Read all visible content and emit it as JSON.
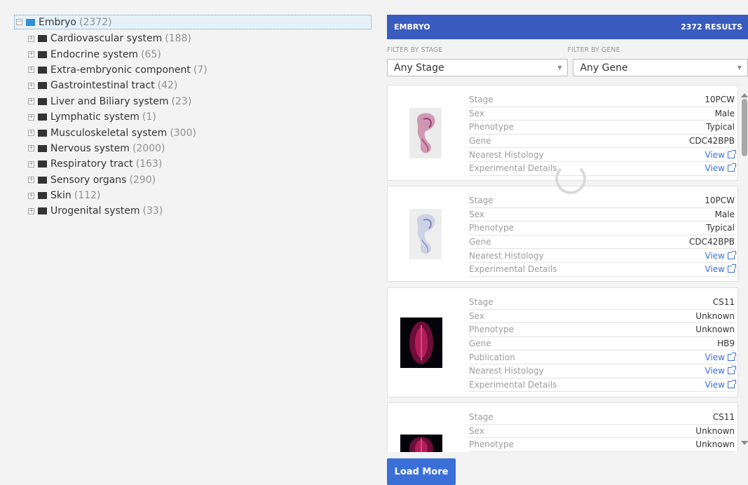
{
  "tree": {
    "root": {
      "label": "Embryo",
      "count": "(2372)"
    },
    "children": [
      {
        "label": "Cardiovascular system",
        "count": "(188)"
      },
      {
        "label": "Endocrine system",
        "count": "(65)"
      },
      {
        "label": "Extra-embryonic component",
        "count": "(7)"
      },
      {
        "label": "Gastrointestinal tract",
        "count": "(42)"
      },
      {
        "label": "Liver and Biliary system",
        "count": "(23)"
      },
      {
        "label": "Lymphatic system",
        "count": "(1)"
      },
      {
        "label": "Musculoskeletal system",
        "count": "(300)"
      },
      {
        "label": "Nervous system",
        "count": "(2000)"
      },
      {
        "label": "Respiratory tract",
        "count": "(163)"
      },
      {
        "label": "Sensory organs",
        "count": "(290)"
      },
      {
        "label": "Skin",
        "count": "(112)"
      },
      {
        "label": "Urogenital system",
        "count": "(33)"
      }
    ]
  },
  "panel": {
    "title": "EMBRYO",
    "results": "2372 RESULTS",
    "filter_stage_label": "FILTER BY STAGE",
    "filter_gene_label": "FILTER BY GENE",
    "stage_value": "Any Stage",
    "gene_value": "Any Gene",
    "load_more": "Load More"
  },
  "cards": [
    {
      "thumb_style": "he-pink",
      "rows": [
        {
          "k": "Stage",
          "v": "10PCW"
        },
        {
          "k": "Sex",
          "v": "Male"
        },
        {
          "k": "Phenotype",
          "v": "Typical"
        },
        {
          "k": "Gene",
          "v": "CDC42BPB"
        },
        {
          "k": "Nearest Histology",
          "v": "View",
          "link": true
        },
        {
          "k": "Experimental Details",
          "v": "View",
          "link": true
        }
      ]
    },
    {
      "thumb_style": "ish-blue",
      "rows": [
        {
          "k": "Stage",
          "v": "10PCW"
        },
        {
          "k": "Sex",
          "v": "Male"
        },
        {
          "k": "Phenotype",
          "v": "Typical"
        },
        {
          "k": "Gene",
          "v": "CDC42BPB"
        },
        {
          "k": "Nearest Histology",
          "v": "View",
          "link": true
        },
        {
          "k": "Experimental Details",
          "v": "View",
          "link": true
        }
      ]
    },
    {
      "thumb_style": "fluor-dark",
      "rows": [
        {
          "k": "Stage",
          "v": "CS11"
        },
        {
          "k": "Sex",
          "v": "Unknown"
        },
        {
          "k": "Phenotype",
          "v": "Unknown"
        },
        {
          "k": "Gene",
          "v": "HB9"
        },
        {
          "k": "Publication",
          "v": "View",
          "link": true
        },
        {
          "k": "Nearest Histology",
          "v": "View",
          "link": true
        },
        {
          "k": "Experimental Details",
          "v": "View",
          "link": true
        }
      ]
    },
    {
      "thumb_style": "fluor-dark",
      "rows": [
        {
          "k": "Stage",
          "v": "CS11"
        },
        {
          "k": "Sex",
          "v": "Unknown"
        },
        {
          "k": "Phenotype",
          "v": "Unknown"
        }
      ]
    }
  ],
  "icons": {
    "root_folder": "folder-open-icon",
    "child_folder": "folder-icon",
    "external_link": "external-link-icon"
  },
  "colors": {
    "header": "#3a5bbf",
    "link": "#3a6fd8",
    "button": "#3a6fd8",
    "tree_selected": "#e6f2fb"
  }
}
